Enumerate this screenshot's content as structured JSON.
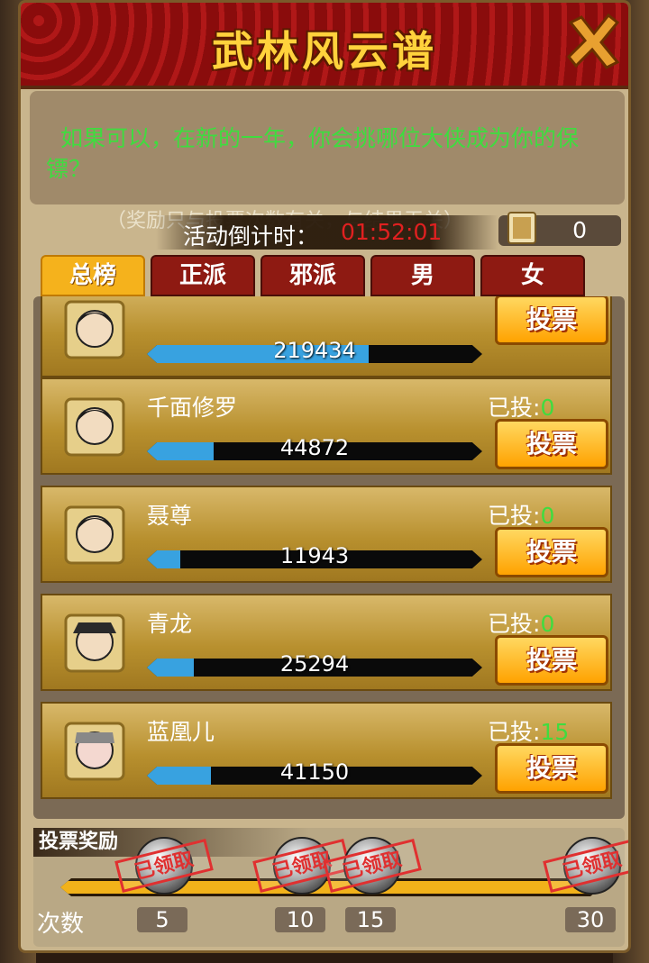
{
  "window": {
    "title": "武林风云谱"
  },
  "question": "如果可以，在新的一年，你会挑哪位大侠成为你的保镖？",
  "notice": "（奖励只与投票次数有关，与结果无关）",
  "countdown": {
    "label": "活动倒计时：",
    "value": "01:52:01"
  },
  "tickets": {
    "count": "0"
  },
  "tabs": [
    {
      "label": "总榜",
      "active": true
    },
    {
      "label": "正派",
      "active": false
    },
    {
      "label": "邪派",
      "active": false
    },
    {
      "label": "男",
      "active": false
    },
    {
      "label": "女",
      "active": false
    }
  ],
  "heroes": [
    {
      "name": "",
      "votes": "219434",
      "voted_label": "",
      "voted_count": "",
      "bar_fraction": 0.66,
      "vote_label": "投票"
    },
    {
      "name": "千面修罗",
      "votes": "44872",
      "voted_label": "已投:",
      "voted_count": "0",
      "bar_fraction": 0.2,
      "vote_label": "投票"
    },
    {
      "name": "聂尊",
      "votes": "11943",
      "voted_label": "已投:",
      "voted_count": "0",
      "bar_fraction": 0.1,
      "vote_label": "投票"
    },
    {
      "name": "青龙",
      "votes": "25294",
      "voted_label": "已投:",
      "voted_count": "0",
      "bar_fraction": 0.14,
      "vote_label": "投票"
    },
    {
      "name": "蓝凰儿",
      "votes": "41150",
      "voted_label": "已投:",
      "voted_count": "15",
      "bar_fraction": 0.19,
      "vote_label": "投票"
    }
  ],
  "rewards": {
    "title": "投票奖励",
    "count_label": "次数",
    "progress_fraction": 0.97,
    "milestones": [
      {
        "count": "5",
        "status": "已领取"
      },
      {
        "count": "10",
        "status": "已领取"
      },
      {
        "count": "15",
        "status": "已领取"
      },
      {
        "count": "30",
        "status": "已领取"
      }
    ]
  },
  "colors": {
    "green": "#3fdc3f",
    "countdown": "#e02020",
    "tab_active": "#f5b21c",
    "tab": "#8e1a12",
    "bar": "#38a2e0"
  }
}
